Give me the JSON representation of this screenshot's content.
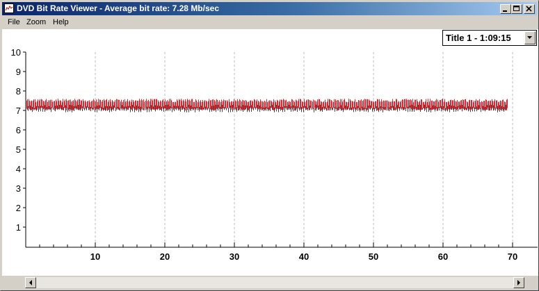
{
  "window": {
    "title": "DVD Bit Rate Viewer - Average bit rate: 7.28 Mb/sec",
    "icon": "chart-icon",
    "controls": [
      "minimize-icon",
      "maximize-icon",
      "close-icon"
    ]
  },
  "menu": {
    "items": [
      "File",
      "Zoom",
      "Help"
    ]
  },
  "title_select": {
    "value": "Title 1 - 1:09:15"
  },
  "scrollbar": {
    "position": 0
  },
  "colors": {
    "bar_high": "#e8222a",
    "bar_low": "#404040",
    "grid": "#b8b8b8"
  },
  "chart_data": {
    "type": "bar",
    "title": "",
    "xlabel": "",
    "ylabel": "",
    "xlim": [
      0,
      70
    ],
    "ylim": [
      0,
      10
    ],
    "x_ticks": [
      10,
      20,
      30,
      40,
      50,
      60,
      70
    ],
    "y_ticks": [
      1,
      2,
      3,
      4,
      5,
      6,
      7,
      8,
      9,
      10
    ],
    "grid": "vertical dashed every 10",
    "x_extent": [
      0,
      69.2
    ],
    "series": [
      {
        "values": {
          "min": 7.0,
          "max": 7.6
        },
        "color": "#e8222a"
      },
      {
        "values": {
          "min": 6.9,
          "max": 7.3
        },
        "color": "#404040"
      }
    ],
    "average": 7.28
  }
}
